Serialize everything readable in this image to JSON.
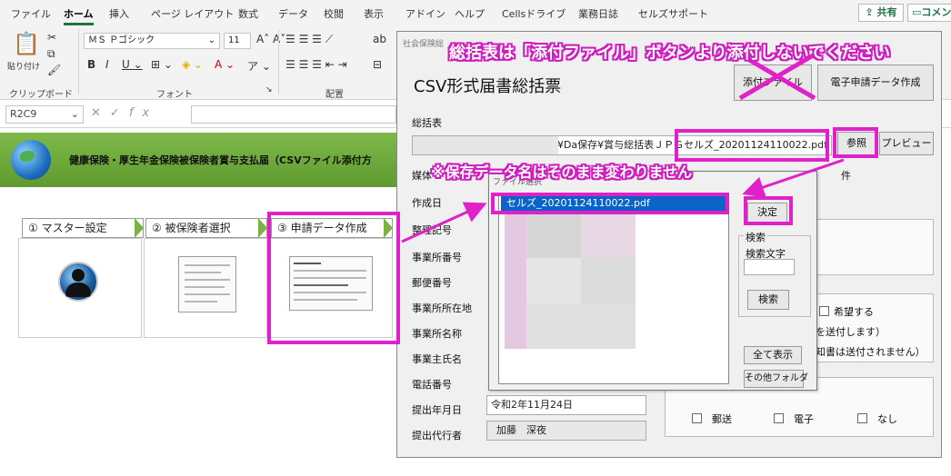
{
  "ribbon": {
    "tabs": [
      "ファイル",
      "ホーム",
      "挿入",
      "ページ レイアウト",
      "数式",
      "データ",
      "校閲",
      "表示",
      "アドイン",
      "ヘルプ",
      "Cellsドライブ",
      "業務日誌",
      "セルズサポート"
    ],
    "share_label": "共有",
    "comment_label": "コメン",
    "paste_label": "貼り付け",
    "font_name": "ＭＳ Ｐゴシック",
    "font_size": "11",
    "groups": {
      "clipboard": "クリップボード",
      "font": "フォント",
      "alignment": "配置"
    }
  },
  "formula_bar": {
    "name_box": "R2C9",
    "fx": "fx"
  },
  "sheet": {
    "banner_title": "健康保険・厚生年金保険被保険者賞与支払届（CSVファイル添付方",
    "steps": [
      "① マスター設定",
      "② 被保険者選択",
      "③ 申請データ作成"
    ]
  },
  "dialog": {
    "caption": "社会保険総",
    "title": "CSV形式届書総括票",
    "attach_button": "添付ファイル",
    "e_app_button": "電子申請データ作成",
    "summary_label": "総括表",
    "path_prefix": "¥Da保存¥賞与総括表ＪＰＧ",
    "path_file": "セルズ_20201124110022.pdf",
    "browse_button": "参照",
    "preview_button": "プレビュー",
    "media_label": "媒体",
    "count_unit": "件",
    "field_labels": [
      "作成日",
      "整理記号",
      "事業所番号",
      "郵便番号",
      "事業所所在地",
      "事業所名称",
      "事業主氏名",
      "電話番号",
      "提出年月日",
      "提出代行者"
    ],
    "submit_date": "令和2年11月24日",
    "agent_name": "加藤　深夜",
    "hope_label": "希望する",
    "note1": "を送付します）",
    "note2": "知書は送付されません）",
    "options": [
      "郵送",
      "電子",
      "なし"
    ]
  },
  "chooser": {
    "caption": "ファイル選択",
    "selected_file": "セルズ_20201124110022.pdf",
    "ok_button": "決定",
    "search_group": "検索",
    "search_label": "検索文字",
    "search_button": "検索",
    "show_all_button": "全て表示",
    "other_folder_button": "その他フォルダ"
  },
  "annotations": {
    "warning": "総括表は「添付ファイル」ボタンより添付しないでください",
    "note": "※保存データ名はそのまま変わりません"
  },
  "colors": {
    "annotation": "#e020c8",
    "excel_green": "#217346",
    "selection": "#0a63c8"
  }
}
